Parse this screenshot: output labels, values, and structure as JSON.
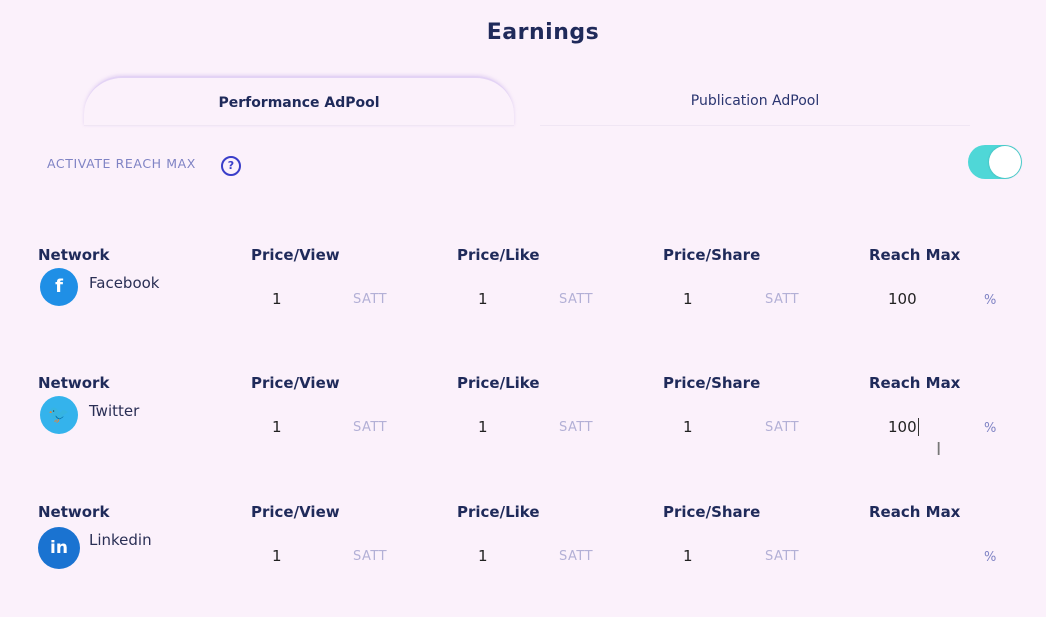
{
  "page_title": "Earnings",
  "tabs": [
    {
      "label": "Performance AdPool",
      "active": true
    },
    {
      "label": "Publication AdPool",
      "active": false
    }
  ],
  "reach_max_toggle": {
    "label": "ACTIVATE REACH MAX",
    "help_glyph": "?",
    "enabled": true
  },
  "columns": {
    "network": "Network",
    "price_view": "Price/View",
    "price_like": "Price/Like",
    "price_share": "Price/Share",
    "reach_max": "Reach Max"
  },
  "currency": "SATT",
  "percent": "%",
  "networks": [
    {
      "name": "Facebook",
      "icon": "facebook-icon",
      "icon_glyph": "f",
      "color": "#1f8fe6",
      "price_view": "1",
      "price_like": "1",
      "price_share": "1",
      "reach_max": "100"
    },
    {
      "name": "Twitter",
      "icon": "twitter-icon",
      "icon_glyph": "🐦",
      "color": "#34b3ec",
      "price_view": "1",
      "price_like": "1",
      "price_share": "1",
      "reach_max": "100"
    },
    {
      "name": "Linkedin",
      "icon": "linkedin-icon",
      "icon_glyph": "in",
      "color": "#1a73d1",
      "price_view": "1",
      "price_like": "1",
      "price_share": "1",
      "reach_max": ""
    }
  ],
  "colors": {
    "accent": "#4fd7d7",
    "heading": "#1f2a5a",
    "unit": "#b3b0d6"
  }
}
